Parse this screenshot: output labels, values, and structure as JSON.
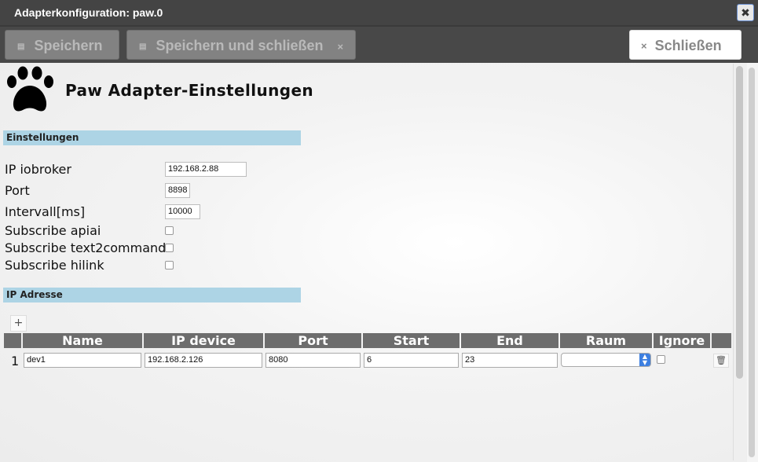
{
  "window": {
    "title": "Adapterkonfiguration: paw.0",
    "close_label": "✖"
  },
  "toolbar": {
    "save_label": "Speichern",
    "save_close_label": "Speichern und schließen",
    "close_label": "Schließen",
    "x_glyph": "×",
    "disk_glyph": "▤"
  },
  "header": {
    "title": "Paw Adapter-Einstellungen"
  },
  "sections": {
    "settings": "Einstellungen",
    "ip": "IP Adresse"
  },
  "settings": {
    "ip_label": "IP iobroker",
    "ip_value": "192.168.2.88",
    "port_label": "Port",
    "port_value": "8898",
    "interval_label": "Intervall[ms]",
    "interval_value": "10000",
    "apiai_label": "Subscribe apiai",
    "apiai_checked": false,
    "text2command_label": "Subscribe text2command",
    "text2command_checked": false,
    "hilink_label": "Subscribe hilink",
    "hilink_checked": false
  },
  "table": {
    "add_label": "+",
    "columns": [
      "Name",
      "IP device",
      "Port",
      "Start",
      "End",
      "Raum",
      "Ignore"
    ],
    "rows": [
      {
        "num": "1",
        "name": "dev1",
        "ip": "192.168.2.126",
        "port": "8080",
        "start": "6",
        "end": "23",
        "raum": "",
        "ignore": false
      }
    ],
    "delete_glyph": "🗑"
  }
}
